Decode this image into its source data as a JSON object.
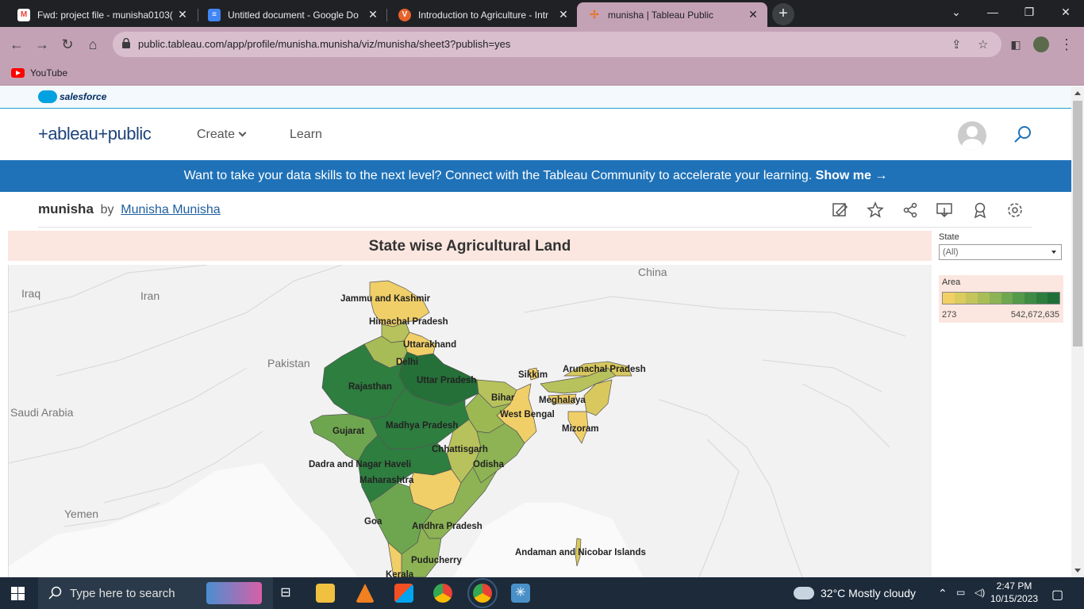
{
  "browser": {
    "tabs": [
      {
        "title": "Fwd: project file - munisha0103(",
        "icon": "gmail-icon",
        "color": "#ea4335"
      },
      {
        "title": "Untitled document - Google Do",
        "icon": "google-docs-icon",
        "color": "#4285f4"
      },
      {
        "title": "Introduction to Agriculture - Intr",
        "icon": "v-icon",
        "color": "#e8622c"
      },
      {
        "title": "munisha | Tableau Public",
        "icon": "tableau-icon",
        "color": "#e8762d"
      }
    ],
    "url": "public.tableau.com/app/profile/munisha.munisha/viz/munisha/sheet3?publish=yes",
    "bookmark": "YouTube"
  },
  "site": {
    "salesforce": "salesforce",
    "logo": "+ableau+public",
    "nav": {
      "create": "Create",
      "learn": "Learn"
    },
    "banner_text": "Want to take your data skills to the next level? Connect with the Tableau Community to accelerate your learning.",
    "banner_cta": "Show me →",
    "viz_name": "munisha",
    "by": "by",
    "author": "Munisha Munisha"
  },
  "dashboard": {
    "title": "State wise Agricultural Land",
    "filter_label": "State",
    "filter_value": "(All)",
    "legend_label": "Area",
    "legend_min": "273",
    "legend_max": "542,672,635",
    "legend_colors": [
      "#f2d066",
      "#dccb5e",
      "#c5c45a",
      "#a9bd57",
      "#8db354",
      "#6fa650",
      "#55994b",
      "#3f8b45",
      "#2d7d3f",
      "#1f6f38"
    ],
    "countries": [
      "China",
      "Iraq",
      "Iran",
      "Pakistan",
      "Saudi Arabia",
      "Yemen"
    ],
    "states": [
      "Jammu and Kashmir",
      "Himachal Pradesh",
      "Uttarakhand",
      "Delhi",
      "Rajasthan",
      "Uttar Pradesh",
      "Sikkim",
      "Arunachal Pradesh",
      "Bihar",
      "Meghalaya",
      "West Bengal",
      "Gujarat",
      "Madhya Pradesh",
      "Mizoram",
      "Chhattisgarh",
      "Odisha",
      "Dadra and Nagar Haveli",
      "Maharashtra",
      "Goa",
      "Andhra Pradesh",
      "Andaman and Nicobar Islands",
      "Puducherry",
      "Kerala"
    ]
  },
  "taskbar": {
    "search_placeholder": "Type here to search",
    "weather": "32°C  Mostly cloudy",
    "time": "2:47 PM",
    "date": "10/15/2023"
  }
}
